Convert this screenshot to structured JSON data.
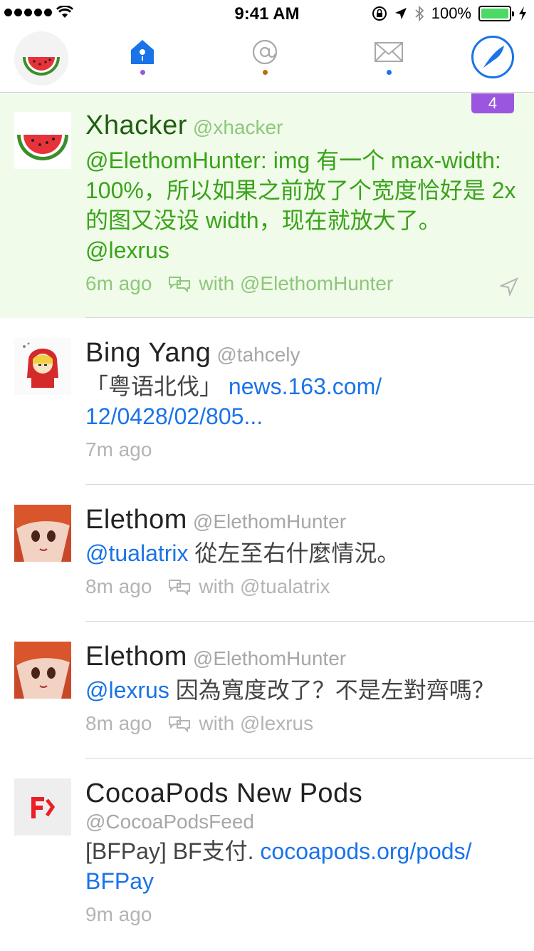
{
  "status_bar": {
    "time": "9:41 AM",
    "battery": "100%"
  },
  "nav": {
    "tabs": [
      {
        "name": "home",
        "dot_color": "#9b56e0",
        "active": true
      },
      {
        "name": "mentions",
        "dot_color": "#c06a10",
        "active": false
      },
      {
        "name": "messages",
        "dot_color": "#1a73e8",
        "active": false
      }
    ]
  },
  "badge": "4",
  "tweets": [
    {
      "name": "Xhacker",
      "handle": "@xhacker",
      "body_prefix": "@ElethomHunter: img 有一个 max-width: 100%，所以如果之前放了个宽度恰好是 2x 的图又没设 width，现在就放大了。 @lexrus",
      "time": "6m ago",
      "with": "with @ElethomHunter"
    },
    {
      "name": "Bing Yang",
      "handle": "@tahcely",
      "body_prefix": "「粤语北伐」 ",
      "link": "news.163.com/ 12/0428/02/805...",
      "time": "7m ago"
    },
    {
      "name": "Elethom",
      "handle": "@ElethomHunter",
      "mention": "@tualatrix",
      "body_text": " 從左至右什麼情況。",
      "time": "8m ago",
      "with": "with @tualatrix"
    },
    {
      "name": "Elethom",
      "handle": "@ElethomHunter",
      "mention": "@lexrus",
      "body_text": " 因為寬度改了？不是左對齊嗎？",
      "time": "8m ago",
      "with": "with @lexrus"
    },
    {
      "name": "CocoaPods New Pods",
      "handle": "@CocoaPodsFeed",
      "body_prefix": "[BFPay] BF支付. ",
      "link": "cocoapods.org/pods/ BFPay",
      "time": "9m ago"
    }
  ]
}
